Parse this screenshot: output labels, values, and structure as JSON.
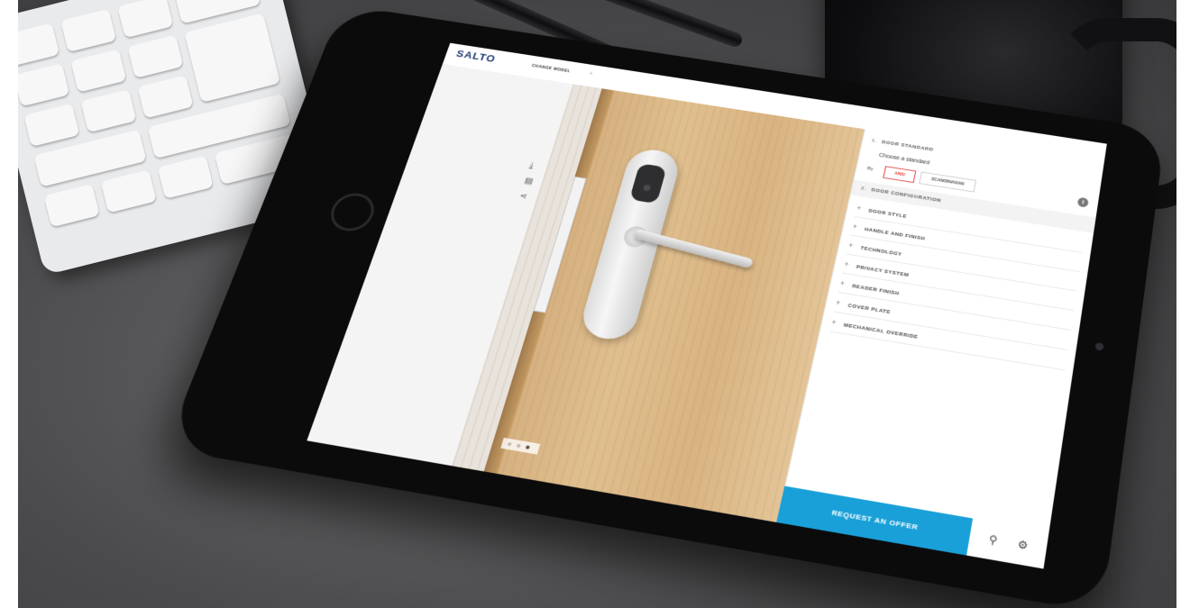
{
  "app": {
    "logo": "SALTO",
    "logo_sub": "",
    "change_model": "CHANGE MODEL",
    "chevron": "˅"
  },
  "viewer": {
    "side_icons": [
      "download-icon",
      "print-icon",
      "share-icon"
    ]
  },
  "panel": {
    "door_standard": {
      "num": "1.",
      "label": "DOOR STANDARD"
    },
    "choose_label": "Choose a standard",
    "standard_row_label": "By",
    "standards": [
      {
        "label": "ANSI",
        "selected": true
      },
      {
        "label": "SCANDINAVIAN",
        "selected": false
      }
    ],
    "door_configuration": {
      "num": "2.",
      "label": "DOOR CONFIGURATION"
    },
    "items": [
      "DOOR STYLE",
      "HANDLE AND FINISH",
      "TECHNOLOGY",
      "PRIVACY SYSTEM",
      "READER FINISH",
      "COVER PLATE",
      "MECHANICAL OVERRIDE"
    ]
  },
  "footer": {
    "request_offer": "REQUEST AN OFFER",
    "icons": [
      "user-icon",
      "settings-icon"
    ]
  },
  "colors": {
    "accent": "#1aa0d8",
    "brand": "#1e3a72",
    "selected_border": "#e24343"
  }
}
